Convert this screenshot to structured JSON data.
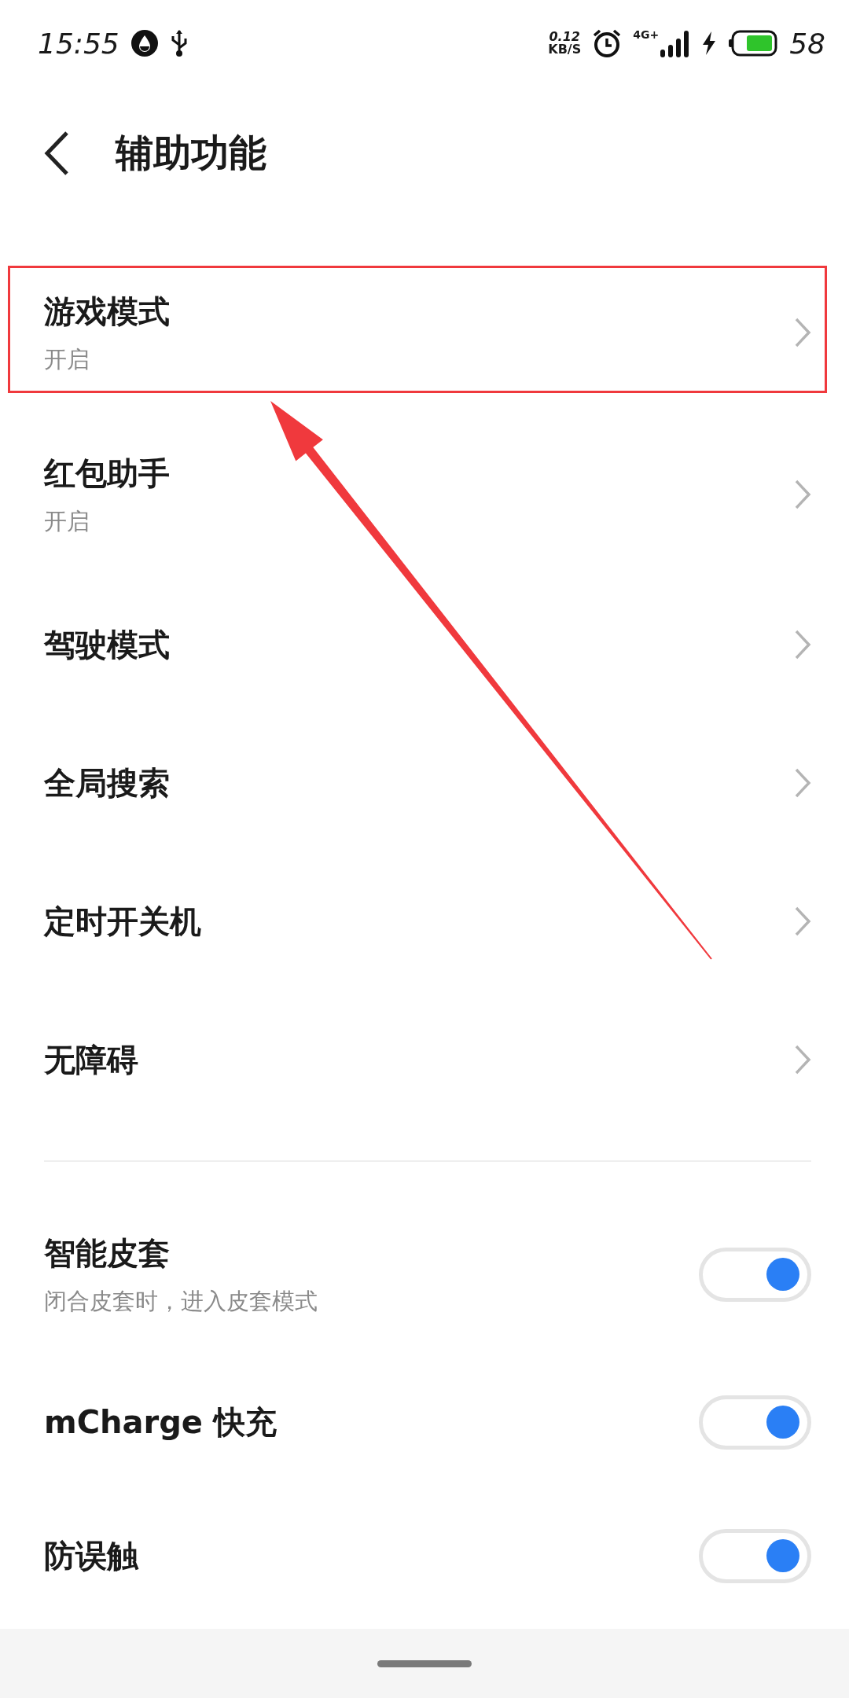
{
  "status_bar": {
    "time": "15:55",
    "net_speed": "0.12",
    "net_unit": "KB/S",
    "network": "4G+",
    "battery": "58"
  },
  "header": {
    "title": "辅助功能"
  },
  "items": [
    {
      "kind": "link",
      "title": "游戏模式",
      "subtitle": "开启",
      "highlighted": true
    },
    {
      "kind": "link",
      "title": "红包助手",
      "subtitle": "开启",
      "highlighted": false
    },
    {
      "kind": "link",
      "title": "驾驶模式",
      "highlighted": false
    },
    {
      "kind": "link",
      "title": "全局搜索",
      "highlighted": false
    },
    {
      "kind": "link",
      "title": "定时开关机",
      "highlighted": false
    },
    {
      "kind": "link",
      "title": "无障碍",
      "highlighted": false
    },
    {
      "kind": "divider"
    },
    {
      "kind": "switch",
      "title": "智能皮套",
      "subtitle": "闭合皮套时，进入皮套模式",
      "on": true
    },
    {
      "kind": "switch",
      "title": "mCharge 快充",
      "on": true
    },
    {
      "kind": "switch",
      "title": "防误触",
      "on": true
    }
  ]
}
